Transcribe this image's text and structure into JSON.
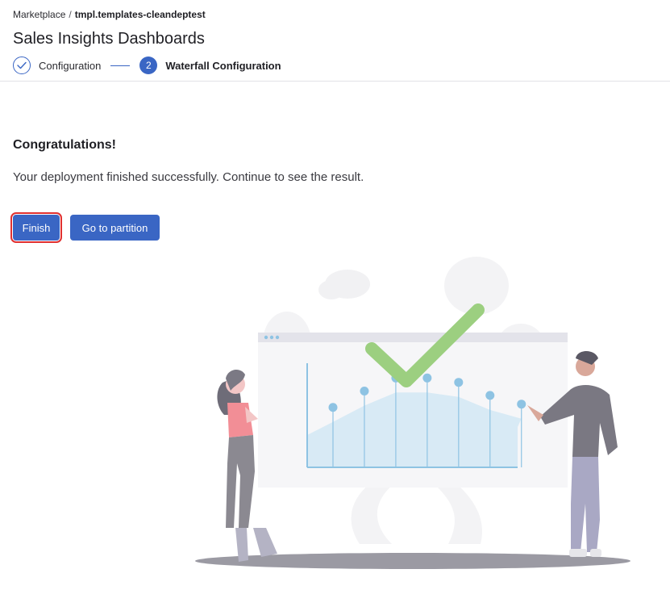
{
  "breadcrumb": {
    "parent": "Marketplace",
    "separator": "/",
    "current": "tmpl.templates-cleandeptest"
  },
  "page": {
    "title": "Sales Insights Dashboards"
  },
  "stepper": {
    "steps": [
      {
        "number": "1",
        "label": "Configuration",
        "state": "completed"
      },
      {
        "number": "2",
        "label": "Waterfall Configuration",
        "state": "active"
      }
    ]
  },
  "result": {
    "heading": "Congratulations!",
    "message": "Your deployment finished successfully. Continue to see the result."
  },
  "actions": {
    "finish_label": "Finish",
    "partition_label": "Go to partition"
  },
  "illustration": {
    "icon": "deployment-success-illustration",
    "chart_values": [
      55,
      70,
      82,
      82,
      78,
      66,
      58
    ],
    "colors": {
      "accent": "#3a66c4",
      "check": "#9ccf80",
      "chart_fill": "#d8eaf5",
      "chart_line": "#8ec3e3"
    }
  }
}
